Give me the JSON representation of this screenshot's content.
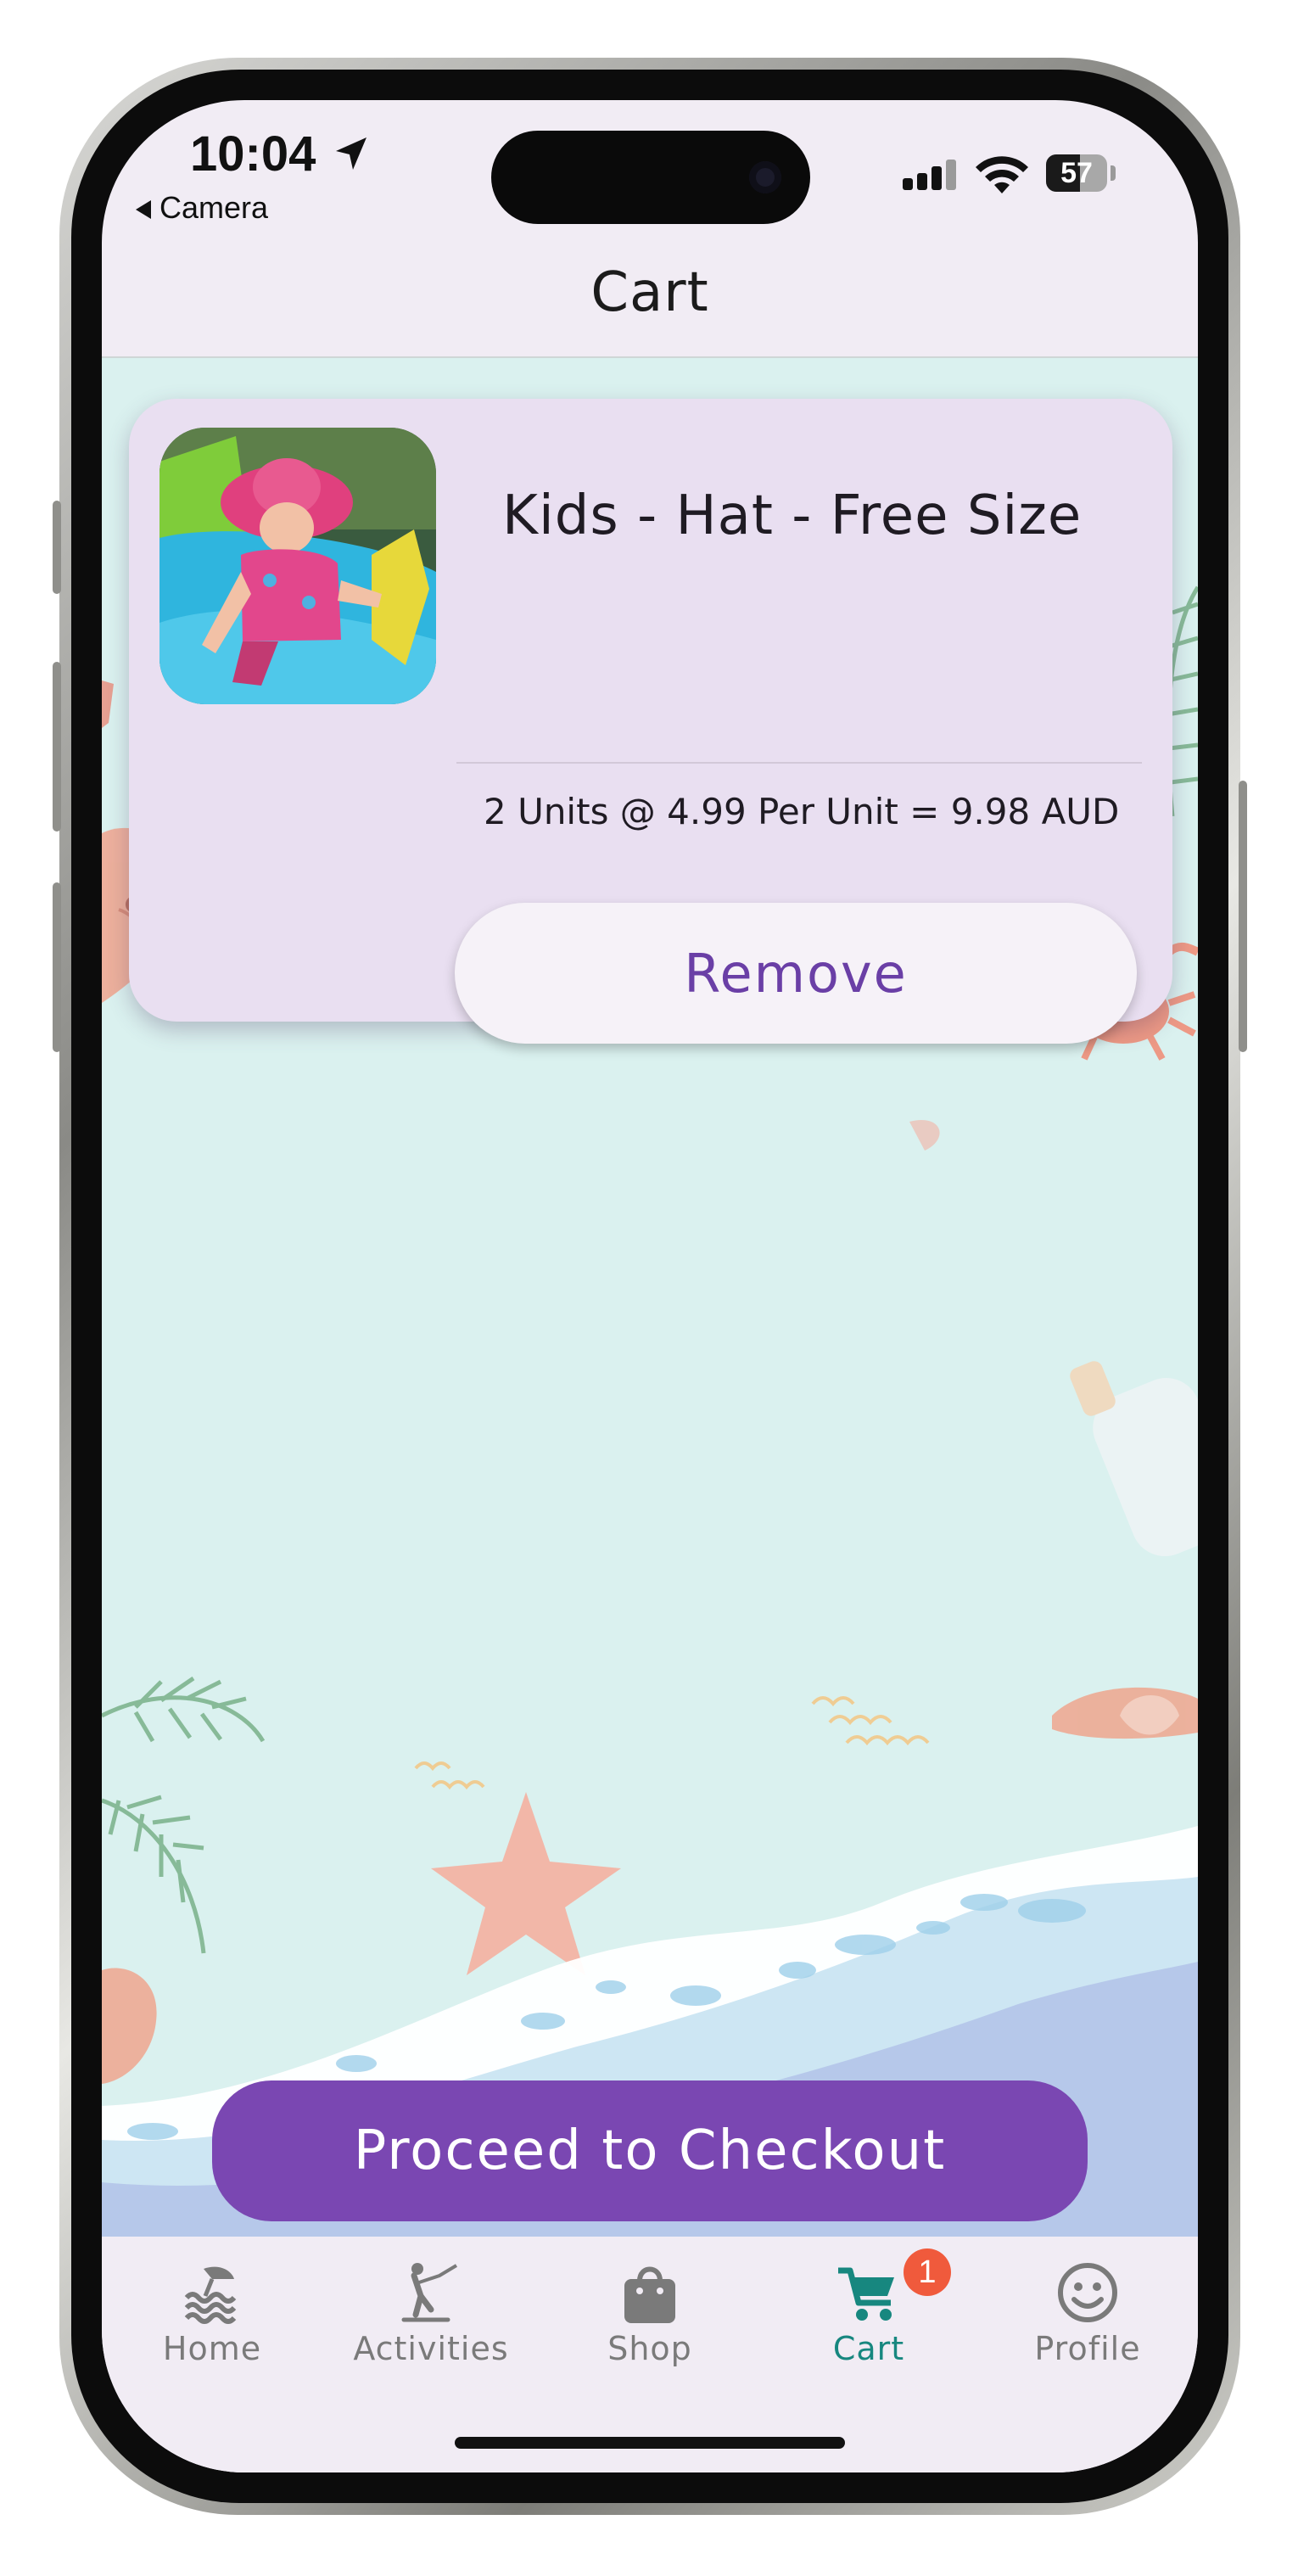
{
  "status_bar": {
    "time": "10:04",
    "back_label": "Camera",
    "battery": "57"
  },
  "header": {
    "title": "Cart"
  },
  "cart": {
    "items": [
      {
        "name": "Kids - Hat - Free Size",
        "summary": "2 Units @ 4.99 Per Unit = 9.98 AUD",
        "remove_label": "Remove"
      }
    ],
    "checkout_label": "Proceed to Checkout"
  },
  "tab_bar": {
    "tabs": [
      {
        "label": "Home",
        "icon": "beach-waves-icon"
      },
      {
        "label": "Activities",
        "icon": "water-ski-icon"
      },
      {
        "label": "Shop",
        "icon": "shopping-bag-icon"
      },
      {
        "label": "Cart",
        "icon": "cart-icon",
        "badge": "1",
        "active": true
      },
      {
        "label": "Profile",
        "icon": "smiley-face-icon"
      }
    ]
  },
  "colors": {
    "accent": "#7a47b2",
    "active_tab": "#17877f",
    "badge": "#f05a3c",
    "content_background": "#daf1ef",
    "card_background": "#e9dff1"
  }
}
